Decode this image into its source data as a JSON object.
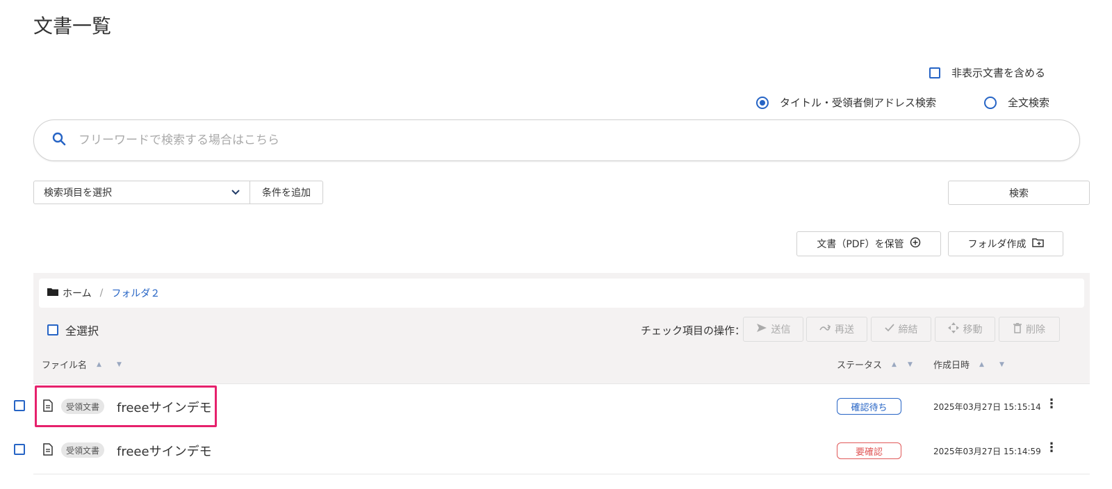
{
  "page": {
    "title": "文書一覧"
  },
  "options": {
    "include_hidden_label": "非表示文書を含める",
    "search_modes": [
      {
        "label": "タイトル・受領者側アドレス検索",
        "selected": true
      },
      {
        "label": "全文検索",
        "selected": false
      }
    ]
  },
  "search": {
    "placeholder": "フリーワードで検索する場合はこちら",
    "value": ""
  },
  "filters": {
    "select_label": "検索項目を選択",
    "add_condition_label": "条件を追加",
    "search_button_label": "検索"
  },
  "actions": {
    "store_pdf_label": "文書（PDF）を保管",
    "create_folder_label": "フォルダ作成"
  },
  "breadcrumb": {
    "home": "ホーム",
    "separator": "/",
    "current": "フォルダ２"
  },
  "list": {
    "select_all_label": "全選択",
    "checked_ops_label": "チェック項目の操作：",
    "ops": [
      {
        "label": "送信",
        "icon": "send-icon"
      },
      {
        "label": "再送",
        "icon": "resend-icon"
      },
      {
        "label": "締結",
        "icon": "check-icon"
      },
      {
        "label": "移動",
        "icon": "move-icon"
      },
      {
        "label": "削除",
        "icon": "trash-icon"
      }
    ],
    "columns": {
      "file_name": "ファイル名",
      "status": "ステータス",
      "created": "作成日時"
    },
    "rows": [
      {
        "tag": "受領文書",
        "name": "freeeサインデモ",
        "status": "確認待ち",
        "status_color": "#2664c5",
        "created": "2025年03月27日 15:15:14"
      },
      {
        "tag": "受領文書",
        "name": "freeeサインデモ",
        "status": "要確認",
        "status_color": "#e05858",
        "created": "2025年03月27日 15:14:59"
      }
    ]
  },
  "colors": {
    "accent": "#2664c5",
    "highlight": "#e6216c",
    "panel_bg": "#f4f2f2"
  }
}
